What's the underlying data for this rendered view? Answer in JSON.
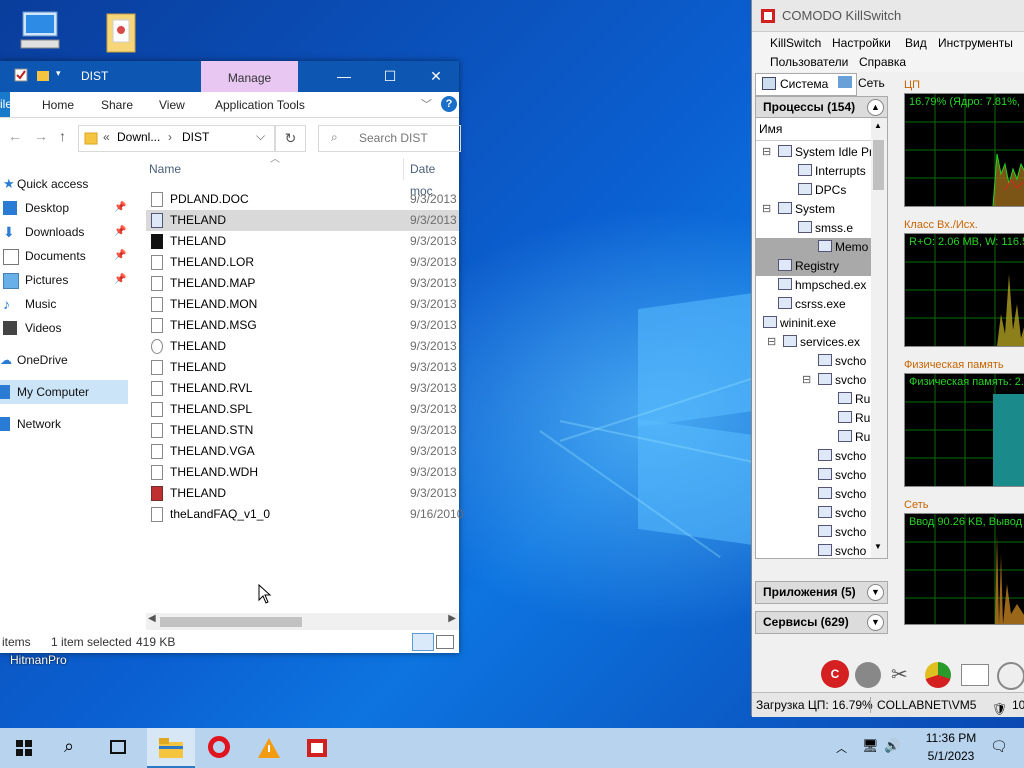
{
  "desktop": {
    "icons": [
      {
        "name": "this-pc-icon"
      },
      {
        "name": "user-folder-icon"
      }
    ],
    "hitman_label": "HitmanPro"
  },
  "explorer": {
    "title": "DIST",
    "manage_tab": "Manage",
    "ribbon_tabs": {
      "file": "ile",
      "home": "Home",
      "share": "Share",
      "view": "View",
      "app_tools": "Application Tools"
    },
    "address": {
      "prefix": "«",
      "path1": "Downl...",
      "sep": "›",
      "path2": "DIST"
    },
    "search_placeholder": "Search DIST",
    "nav": {
      "quick_access": "Quick access",
      "desktop": "Desktop",
      "downloads": "Downloads",
      "documents": "Documents",
      "pictures": "Pictures",
      "music": "Music",
      "videos": "Videos",
      "onedrive": "OneDrive",
      "my_computer": "My Computer",
      "network": "Network"
    },
    "columns": {
      "name": "Name",
      "date": "Date moc"
    },
    "files": [
      {
        "name": "PDLAND.DOC",
        "date": "9/3/2013"
      },
      {
        "name": "THELAND",
        "date": "9/3/2013"
      },
      {
        "name": "THELAND",
        "date": "9/3/2013"
      },
      {
        "name": "THELAND.LOR",
        "date": "9/3/2013"
      },
      {
        "name": "THELAND.MAP",
        "date": "9/3/2013"
      },
      {
        "name": "THELAND.MON",
        "date": "9/3/2013"
      },
      {
        "name": "THELAND.MSG",
        "date": "9/3/2013"
      },
      {
        "name": "THELAND",
        "date": "9/3/2013"
      },
      {
        "name": "THELAND",
        "date": "9/3/2013"
      },
      {
        "name": "THELAND.RVL",
        "date": "9/3/2013"
      },
      {
        "name": "THELAND.SPL",
        "date": "9/3/2013"
      },
      {
        "name": "THELAND.STN",
        "date": "9/3/2013"
      },
      {
        "name": "THELAND.VGA",
        "date": "9/3/2013"
      },
      {
        "name": "THELAND.WDH",
        "date": "9/3/2013"
      },
      {
        "name": "THELAND",
        "date": "9/3/2013"
      },
      {
        "name": "theLandFAQ_v1_0",
        "date": "9/16/2010"
      }
    ],
    "status": {
      "items": "items",
      "selected": "1 item selected",
      "size": "419 KB"
    }
  },
  "killswitch": {
    "title": "COMODO KillSwitch",
    "menu": [
      "KillSwitch",
      "Настройки",
      "Вид",
      "Инструменты",
      "Пользователи",
      "Справка"
    ],
    "tabs": {
      "system": "Система",
      "network": "Сеть"
    },
    "sections": {
      "processes": "Процессы (154)",
      "apps": "Приложения (5)",
      "services": "Сервисы (629)"
    },
    "tree_header": "Имя",
    "tree": [
      "System Idle Pr",
      "Interrupts",
      "DPCs",
      "System",
      "smss.e",
      "Memo",
      "Registry",
      "hmpsched.ex",
      "csrss.exe",
      "wininit.exe",
      "services.ex",
      "svcho",
      "svcho",
      "Ru",
      "Ru",
      "Ru",
      "svcho",
      "svcho",
      "svcho",
      "svcho",
      "svcho",
      "svcho"
    ],
    "graphs": [
      {
        "label": "ЦП",
        "text": "16.79% (Ядро: 7.81%,"
      },
      {
        "label": "Класс Вх./Исх.",
        "text": "R+O: 2.06 MB, W: 116.5"
      },
      {
        "label": "Физическая память",
        "text": "Физическая память: 2."
      },
      {
        "label": "Сеть",
        "text": "Ввод 90.26 KB, Вывод"
      }
    ],
    "status": {
      "cpu": "Загрузка ЦП: 16.79%",
      "host": "COLLABNET\\VM5",
      "extra": "10"
    }
  },
  "taskbar": {
    "time": "11:36 PM",
    "date": "5/1/2023"
  },
  "colors": {
    "explorer_title": "#0d57b3",
    "manage_tab": "#e8c8f3",
    "graph_green": "#26d326",
    "graph_label": "#c86400",
    "taskbar": "#b7d3ee"
  }
}
